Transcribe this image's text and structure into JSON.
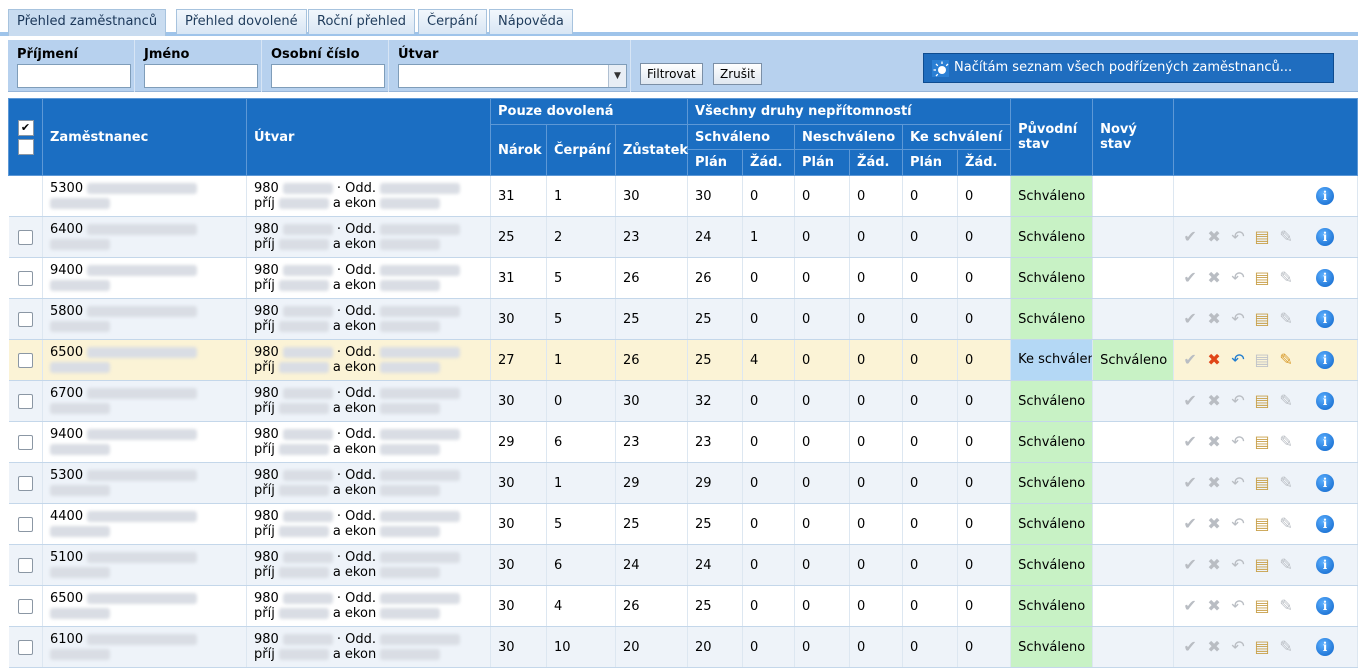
{
  "tabs": [
    {
      "label": "Přehled zaměstnanců",
      "active": true
    },
    {
      "label": "Přehled dovolené",
      "active": false
    },
    {
      "label": "Roční přehled",
      "active": false
    },
    {
      "label": "Čerpání",
      "active": false
    },
    {
      "label": "Nápověda",
      "active": false
    }
  ],
  "filters": {
    "prijmeni_label": "Příjmení",
    "jmeno_label": "Jméno",
    "osobni_cislo_label": "Osobní číslo",
    "utvar_label": "Útvar",
    "filter_button": "Filtrovat",
    "cancel_button": "Zrušit",
    "loading_text": "Načítám seznam všech podřízených zaměstnanců..."
  },
  "table": {
    "headers": {
      "employee": "Zaměstnanec",
      "utvar": "Útvar",
      "pouze_dovolena": "Pouze dovolená",
      "narok": "Nárok",
      "cerpani": "Čerpání",
      "zustatek": "Zůstatek",
      "vsechny_druhy": "Všechny druhy nepřítomností",
      "schvaleno": "Schváleno",
      "neschvaleno": "Neschváleno",
      "ke_schvaleni": "Ke schválení",
      "plan": "Plán",
      "zad": "Žád.",
      "puvodni_stav": "Původní stav",
      "novy_stav": "Nový stav"
    },
    "rows": [
      {
        "id": "5300",
        "utvar_code": "980",
        "utvar_a": "Odd.",
        "utvar_b": "příj",
        "utvar_c": "a ekon",
        "narok": "31",
        "cerpani": "1",
        "zustatek": "30",
        "s_plan": "30",
        "s_zad": "0",
        "n_plan": "0",
        "n_zad": "0",
        "k_plan": "0",
        "k_zad": "0",
        "puvodni": "Schváleno",
        "novy": "",
        "checkbox": false
      },
      {
        "id": "6400",
        "utvar_code": "980",
        "utvar_a": "Odd.",
        "utvar_b": "příj",
        "utvar_c": "a ekon",
        "narok": "25",
        "cerpani": "2",
        "zustatek": "23",
        "s_plan": "24",
        "s_zad": "1",
        "n_plan": "0",
        "n_zad": "0",
        "k_plan": "0",
        "k_zad": "0",
        "puvodni": "Schváleno",
        "novy": "",
        "checkbox": true
      },
      {
        "id": "9400",
        "utvar_code": "980",
        "utvar_a": "Odd.",
        "utvar_b": "příj",
        "utvar_c": "a ekon",
        "narok": "31",
        "cerpani": "5",
        "zustatek": "26",
        "s_plan": "26",
        "s_zad": "0",
        "n_plan": "0",
        "n_zad": "0",
        "k_plan": "0",
        "k_zad": "0",
        "puvodni": "Schváleno",
        "novy": "",
        "checkbox": true
      },
      {
        "id": "5800",
        "utvar_code": "980",
        "utvar_a": "Odd.",
        "utvar_b": "příj",
        "utvar_c": "a ekon",
        "narok": "30",
        "cerpani": "5",
        "zustatek": "25",
        "s_plan": "25",
        "s_zad": "0",
        "n_plan": "0",
        "n_zad": "0",
        "k_plan": "0",
        "k_zad": "0",
        "puvodni": "Schváleno",
        "novy": "",
        "checkbox": true
      },
      {
        "id": "6500",
        "utvar_code": "980",
        "utvar_a": "Odd.",
        "utvar_b": "příj",
        "utvar_c": "a ekon",
        "narok": "27",
        "cerpani": "1",
        "zustatek": "26",
        "s_plan": "25",
        "s_zad": "4",
        "n_plan": "0",
        "n_zad": "0",
        "k_plan": "0",
        "k_zad": "0",
        "puvodni": "Ke schválení",
        "novy": "Schváleno",
        "checkbox": true
      },
      {
        "id": "6700",
        "utvar_code": "980",
        "utvar_a": "Odd.",
        "utvar_b": "příj",
        "utvar_c": "a ekon",
        "narok": "30",
        "cerpani": "0",
        "zustatek": "30",
        "s_plan": "32",
        "s_zad": "0",
        "n_plan": "0",
        "n_zad": "0",
        "k_plan": "0",
        "k_zad": "0",
        "puvodni": "Schváleno",
        "novy": "",
        "checkbox": true
      },
      {
        "id": "9400",
        "utvar_code": "980",
        "utvar_a": "Odd.",
        "utvar_b": "příj",
        "utvar_c": "a ekon",
        "narok": "29",
        "cerpani": "6",
        "zustatek": "23",
        "s_plan": "23",
        "s_zad": "0",
        "n_plan": "0",
        "n_zad": "0",
        "k_plan": "0",
        "k_zad": "0",
        "puvodni": "Schváleno",
        "novy": "",
        "checkbox": true
      },
      {
        "id": "5300",
        "utvar_code": "980",
        "utvar_a": "Odd.",
        "utvar_b": "příj",
        "utvar_c": "a ekon",
        "narok": "30",
        "cerpani": "1",
        "zustatek": "29",
        "s_plan": "29",
        "s_zad": "0",
        "n_plan": "0",
        "n_zad": "0",
        "k_plan": "0",
        "k_zad": "0",
        "puvodni": "Schváleno",
        "novy": "",
        "checkbox": true
      },
      {
        "id": "4400",
        "utvar_code": "980",
        "utvar_a": "Odd.",
        "utvar_b": "příj",
        "utvar_c": "a ekon",
        "narok": "30",
        "cerpani": "5",
        "zustatek": "25",
        "s_plan": "25",
        "s_zad": "0",
        "n_plan": "0",
        "n_zad": "0",
        "k_plan": "0",
        "k_zad": "0",
        "puvodni": "Schváleno",
        "novy": "",
        "checkbox": true
      },
      {
        "id": "5100",
        "utvar_code": "980",
        "utvar_a": "Odd.",
        "utvar_b": "příj",
        "utvar_c": "a ekon",
        "narok": "30",
        "cerpani": "6",
        "zustatek": "24",
        "s_plan": "24",
        "s_zad": "0",
        "n_plan": "0",
        "n_zad": "0",
        "k_plan": "0",
        "k_zad": "0",
        "puvodni": "Schváleno",
        "novy": "",
        "checkbox": true
      },
      {
        "id": "6500",
        "utvar_code": "980",
        "utvar_a": "Odd.",
        "utvar_b": "příj",
        "utvar_c": "a ekon",
        "narok": "30",
        "cerpani": "4",
        "zustatek": "26",
        "s_plan": "25",
        "s_zad": "0",
        "n_plan": "0",
        "n_zad": "0",
        "k_plan": "0",
        "k_zad": "0",
        "puvodni": "Schváleno",
        "novy": "",
        "checkbox": true
      },
      {
        "id": "6100",
        "utvar_code": "980",
        "utvar_a": "Odd.",
        "utvar_b": "příj",
        "utvar_c": "a ekon",
        "narok": "30",
        "cerpani": "10",
        "zustatek": "20",
        "s_plan": "20",
        "s_zad": "0",
        "n_plan": "0",
        "n_zad": "0",
        "k_plan": "0",
        "k_zad": "0",
        "puvodni": "Schváleno",
        "novy": "",
        "checkbox": true
      }
    ]
  },
  "icons": {
    "approve": "check-icon",
    "reject": "x-icon",
    "undo": "undo-icon",
    "add_doc": "add-document-icon",
    "edit": "edit-icon",
    "info": "info-icon",
    "loading": "sun-loading-icon"
  },
  "colors": {
    "header_blue": "#1b6ec2",
    "filter_bg": "#b7d1ee",
    "status_green": "#c8f2c5",
    "status_blue": "#b4d8f5",
    "highlight_row": "#fbf3d6"
  }
}
